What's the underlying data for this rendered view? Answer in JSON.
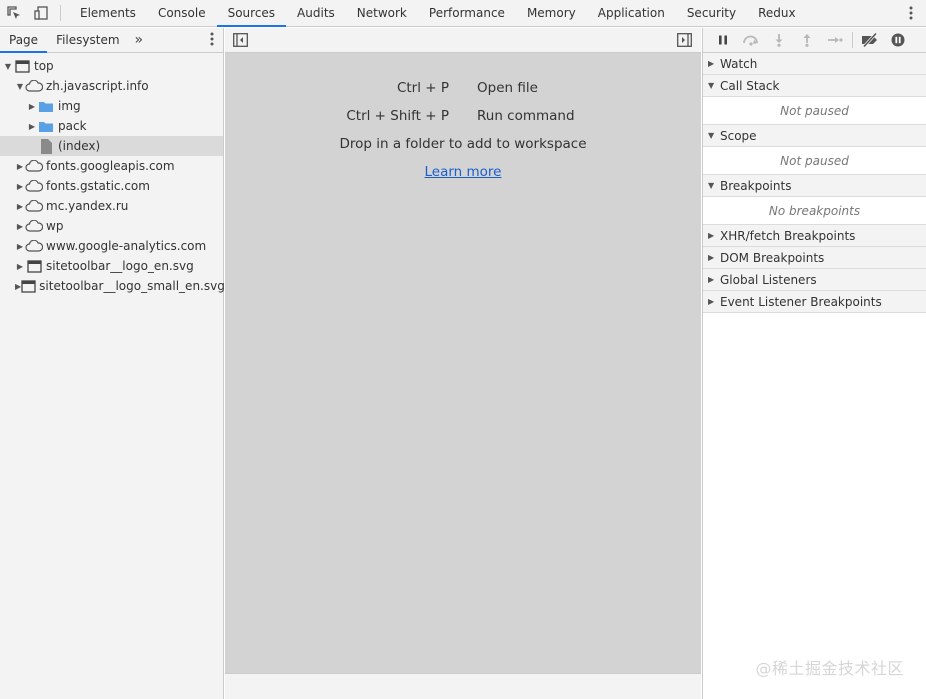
{
  "toolbar": {
    "tabs": [
      {
        "label": "Elements"
      },
      {
        "label": "Console"
      },
      {
        "label": "Sources"
      },
      {
        "label": "Audits"
      },
      {
        "label": "Network"
      },
      {
        "label": "Performance"
      },
      {
        "label": "Memory"
      },
      {
        "label": "Application"
      },
      {
        "label": "Security"
      },
      {
        "label": "Redux"
      }
    ],
    "active_tab": "Sources"
  },
  "navigator": {
    "tabs": [
      {
        "label": "Page"
      },
      {
        "label": "Filesystem"
      }
    ],
    "more": "»",
    "tree": [
      {
        "label": "top",
        "icon": "frame-icon",
        "expanded": true
      },
      {
        "label": "zh.javascript.info",
        "icon": "cloud-icon",
        "expanded": true
      },
      {
        "label": "img",
        "icon": "folder-icon"
      },
      {
        "label": "pack",
        "icon": "folder-icon"
      },
      {
        "label": "(index)",
        "icon": "file-icon",
        "selected": true
      },
      {
        "label": "fonts.googleapis.com",
        "icon": "cloud-icon"
      },
      {
        "label": "fonts.gstatic.com",
        "icon": "cloud-icon"
      },
      {
        "label": "mc.yandex.ru",
        "icon": "cloud-icon"
      },
      {
        "label": "wp",
        "icon": "cloud-icon"
      },
      {
        "label": "www.google-analytics.com",
        "icon": "cloud-icon"
      },
      {
        "label": "sitetoolbar__logo_en.svg",
        "icon": "frame-icon"
      },
      {
        "label": "sitetoolbar__logo_small_en.svg",
        "icon": "frame-icon"
      }
    ]
  },
  "editor": {
    "shortcuts": [
      {
        "keys": "Ctrl + P",
        "action": "Open file"
      },
      {
        "keys": "Ctrl + Shift + P",
        "action": "Run command"
      }
    ],
    "drop_text": "Drop in a folder to add to workspace",
    "learn_more": "Learn more"
  },
  "debugger": {
    "panes": [
      {
        "label": "Watch",
        "expanded": false
      },
      {
        "label": "Call Stack",
        "expanded": true,
        "body": "Not paused"
      },
      {
        "label": "Scope",
        "expanded": true,
        "body": "Not paused"
      },
      {
        "label": "Breakpoints",
        "expanded": true,
        "body": "No breakpoints"
      },
      {
        "label": "XHR/fetch Breakpoints",
        "expanded": false
      },
      {
        "label": "DOM Breakpoints",
        "expanded": false
      },
      {
        "label": "Global Listeners",
        "expanded": false
      },
      {
        "label": "Event Listener Breakpoints",
        "expanded": false
      }
    ]
  },
  "watermark": "@稀土掘金技术社区",
  "colors": {
    "accent": "#1a73e8",
    "folder": "#5aa0e6",
    "editor_bg": "#d3d3d3",
    "link": "#1a5fcc"
  }
}
